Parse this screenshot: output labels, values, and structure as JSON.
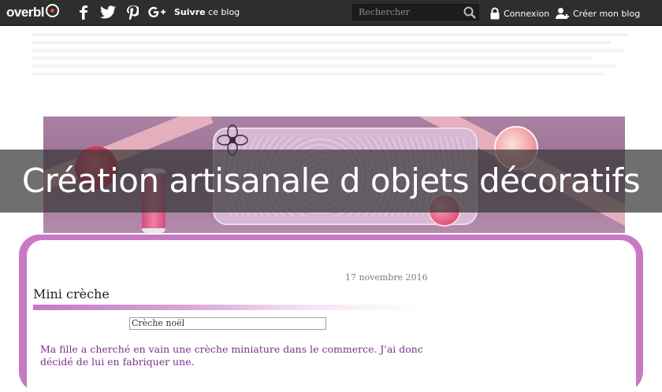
{
  "topbar": {
    "logo_text": "overbl",
    "follow_bold": "Suivre",
    "follow_rest": "ce blog",
    "search_placeholder": "Rechercher",
    "login_label": "Connexion",
    "create_blog_label": "Créer mon blog",
    "social_icons": [
      "facebook-icon",
      "twitter-icon",
      "pinterest-icon",
      "google-plus-icon"
    ]
  },
  "banner": {
    "overlay_title": "Création artisanale d objets décoratifs"
  },
  "post": {
    "date": "17 novembre 2016",
    "title": "Mini crèche",
    "image_alt": "Crèche noël",
    "text": "Ma fille a cherché en vain une crèche miniature dans le commerce. J'ai donc décidé de lui en fabriquer une."
  },
  "colors": {
    "topbar": "#2e2e2e",
    "accent_logo": "#e94f2b",
    "content_frame": "#c879c4",
    "post_text": "#7d2e8c"
  }
}
